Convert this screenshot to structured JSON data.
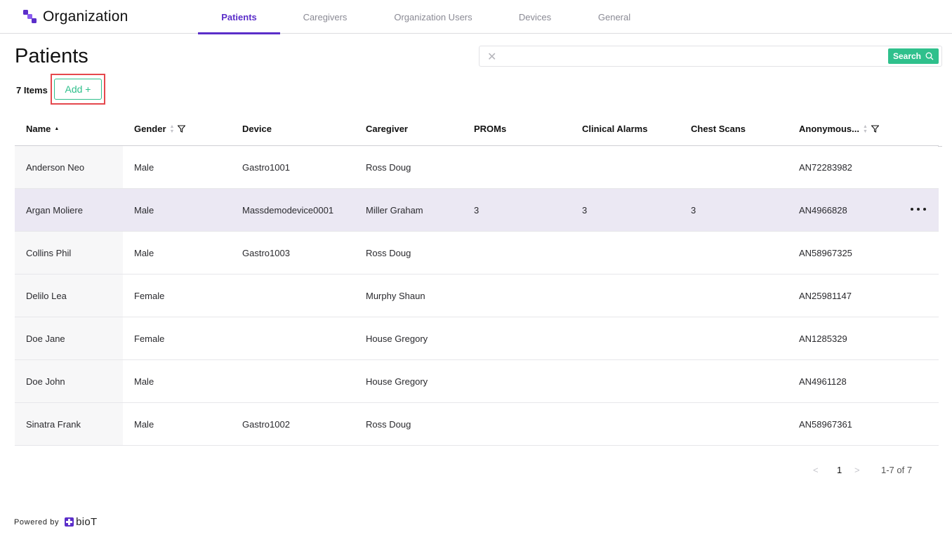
{
  "header": {
    "brand": "Organization",
    "tabs": [
      {
        "label": "Patients",
        "active": true
      },
      {
        "label": "Caregivers"
      },
      {
        "label": "Organization Users"
      },
      {
        "label": "Devices"
      },
      {
        "label": "General"
      }
    ],
    "accent_color": "#5b2ec9"
  },
  "page": {
    "title": "Patients",
    "items_count": "7 Items",
    "add_label": "Add +"
  },
  "search": {
    "value": "",
    "placeholder": "",
    "button_label": "Search",
    "button_color": "#2fc08c"
  },
  "table": {
    "columns": [
      "Name",
      "Gender",
      "Device",
      "Caregiver",
      "PROMs",
      "Clinical Alarms",
      "Chest Scans",
      "Anonymous..."
    ],
    "rows": [
      {
        "name": "Anderson Neo",
        "gender": "Male",
        "device": "Gastro1001",
        "caregiver": "Ross Doug",
        "proms": "",
        "alarms": "",
        "scans": "",
        "anon": "AN72283982"
      },
      {
        "name": "Argan Moliere",
        "gender": "Male",
        "device": "Massdemodevice0001",
        "caregiver": "Miller Graham",
        "proms": "3",
        "alarms": "3",
        "scans": "3",
        "anon": "AN4966828"
      },
      {
        "name": "Collins Phil",
        "gender": "Male",
        "device": "Gastro1003",
        "caregiver": "Ross Doug",
        "proms": "",
        "alarms": "",
        "scans": "",
        "anon": "AN58967325"
      },
      {
        "name": "Delilo Lea",
        "gender": "Female",
        "device": "",
        "caregiver": "Murphy Shaun",
        "proms": "",
        "alarms": "",
        "scans": "",
        "anon": "AN25981147"
      },
      {
        "name": "Doe Jane",
        "gender": "Female",
        "device": "",
        "caregiver": "House Gregory",
        "proms": "",
        "alarms": "",
        "scans": "",
        "anon": "AN1285329"
      },
      {
        "name": "Doe John",
        "gender": "Male",
        "device": "",
        "caregiver": "House Gregory",
        "proms": "",
        "alarms": "",
        "scans": "",
        "anon": "AN4961128"
      },
      {
        "name": "Sinatra Frank",
        "gender": "Male",
        "device": "Gastro1002",
        "caregiver": "Ross Doug",
        "proms": "",
        "alarms": "",
        "scans": "",
        "anon": "AN58967361"
      }
    ]
  },
  "pagination": {
    "prev": "<",
    "current": "1",
    "next": ">",
    "range": "1-7 of 7"
  },
  "footer": {
    "powered_by": "Powered by",
    "brand": "bioT"
  }
}
